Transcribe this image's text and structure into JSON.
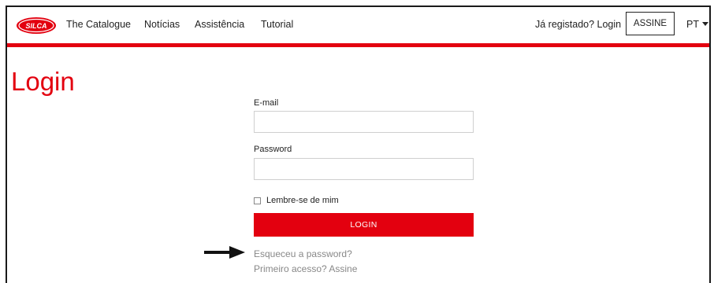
{
  "brand": {
    "logo_text": "SILCA",
    "accent_color": "#e3000f"
  },
  "nav": {
    "links": [
      "The Catalogue",
      "Notícias",
      "Assistência",
      "Tutorial"
    ],
    "login_link": "Já registado? Login",
    "subscribe_label": "ASSINE",
    "language": "PT"
  },
  "page": {
    "title": "Login"
  },
  "form": {
    "email_label": "E-mail",
    "email_value": "",
    "password_label": "Password",
    "password_value": "",
    "remember_label": "Lembre-se de mim",
    "remember_checked": false,
    "submit_label": "LOGIN",
    "forgot_link": "Esqueceu a password?",
    "first_access_link": "Primeiro acesso? Assine"
  }
}
